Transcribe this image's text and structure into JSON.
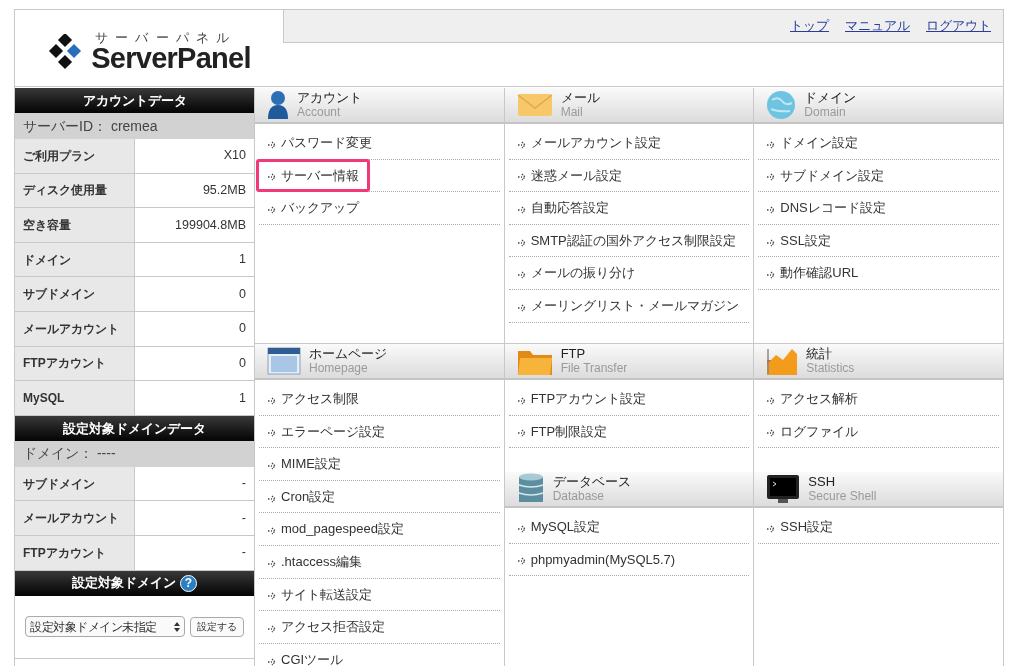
{
  "header": {
    "logo": {
      "kana": "サーバーパネル",
      "brand": "ServerPanel"
    },
    "nav_links": [
      "トップ",
      "マニュアル",
      "ログアウト"
    ]
  },
  "sidebar": {
    "account_data": {
      "title": "アカウントデータ",
      "info": "サーバーID： cremea",
      "rows": [
        {
          "label": "ご利用プラン",
          "value": "X10"
        },
        {
          "label": "ディスク使用量",
          "value": "95.2MB"
        },
        {
          "label": "空き容量",
          "value": "199904.8MB"
        },
        {
          "label": "ドメイン",
          "value": "1"
        },
        {
          "label": "サブドメイン",
          "value": "0"
        },
        {
          "label": "メールアカウント",
          "value": "0"
        },
        {
          "label": "FTPアカウント",
          "value": "0"
        },
        {
          "label": "MySQL",
          "value": "1"
        }
      ]
    },
    "domain_data": {
      "title": "設定対象ドメインデータ",
      "info": "ドメイン： ----",
      "rows": [
        {
          "label": "サブドメイン",
          "value": "-"
        },
        {
          "label": "メールアカウント",
          "value": "-"
        },
        {
          "label": "FTPアカウント",
          "value": "-"
        }
      ]
    },
    "domain_select": {
      "title": "設定対象ドメイン",
      "help": "?",
      "select_value": "設定対象ドメイン未指定",
      "button": "設定する"
    }
  },
  "menu": {
    "top_band": [
      {
        "kind": "account",
        "title": "アカウント",
        "subtitle": "Account",
        "items": [
          {
            "label": "パスワード変更",
            "highlighted": false
          },
          {
            "label": "サーバー情報",
            "highlighted": true
          },
          {
            "label": "バックアップ",
            "highlighted": false
          }
        ]
      },
      {
        "kind": "mail",
        "title": "メール",
        "subtitle": "Mail",
        "items": [
          {
            "label": "メールアカウント設定",
            "highlighted": false
          },
          {
            "label": "迷惑メール設定",
            "highlighted": false
          },
          {
            "label": "自動応答設定",
            "highlighted": false
          },
          {
            "label": "SMTP認証の国外アクセス制限設定",
            "highlighted": false
          },
          {
            "label": "メールの振り分け",
            "highlighted": false
          },
          {
            "label": "メーリングリスト・メールマガジン",
            "highlighted": false
          }
        ]
      },
      {
        "kind": "domain",
        "title": "ドメイン",
        "subtitle": "Domain",
        "items": [
          {
            "label": "ドメイン設定",
            "highlighted": false
          },
          {
            "label": "サブドメイン設定",
            "highlighted": false
          },
          {
            "label": "DNSレコード設定",
            "highlighted": false
          },
          {
            "label": "SSL設定",
            "highlighted": false
          },
          {
            "label": "動作確認URL",
            "highlighted": false
          }
        ]
      }
    ],
    "bottom_band": [
      [
        {
          "kind": "homepage",
          "title": "ホームページ",
          "subtitle": "Homepage",
          "items": [
            {
              "label": "アクセス制限",
              "highlighted": false
            },
            {
              "label": "エラーページ設定",
              "highlighted": false
            },
            {
              "label": "MIME設定",
              "highlighted": false
            },
            {
              "label": "Cron設定",
              "highlighted": false
            },
            {
              "label": "mod_pagespeed設定",
              "highlighted": false
            },
            {
              "label": ".htaccess編集",
              "highlighted": false
            },
            {
              "label": "サイト転送設定",
              "highlighted": false
            },
            {
              "label": "アクセス拒否設定",
              "highlighted": false
            },
            {
              "label": "CGIツール",
              "highlighted": false
            }
          ]
        }
      ],
      [
        {
          "kind": "ftp",
          "title": "FTP",
          "subtitle": "File Transfer",
          "items": [
            {
              "label": "FTPアカウント設定",
              "highlighted": false
            },
            {
              "label": "FTP制限設定",
              "highlighted": false
            }
          ]
        },
        {
          "kind": "database",
          "title": "データベース",
          "subtitle": "Database",
          "items": [
            {
              "label": "MySQL設定",
              "highlighted": false
            },
            {
              "label": "phpmyadmin(MySQL5.7)",
              "highlighted": false
            }
          ]
        }
      ],
      [
        {
          "kind": "statistics",
          "title": "統計",
          "subtitle": "Statistics",
          "items": [
            {
              "label": "アクセス解析",
              "highlighted": false
            },
            {
              "label": "ログファイル",
              "highlighted": false
            }
          ]
        },
        {
          "kind": "ssh",
          "title": "SSH",
          "subtitle": "Secure Shell",
          "items": [
            {
              "label": "SSH設定",
              "highlighted": false
            }
          ]
        }
      ]
    ]
  }
}
